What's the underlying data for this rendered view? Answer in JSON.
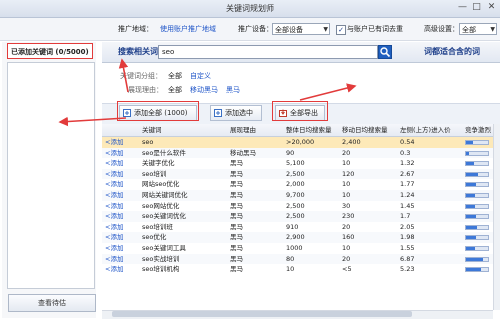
{
  "window": {
    "title": "关键词规划师"
  },
  "settings": {
    "region_label": "推广地域：",
    "region_value": "使用账户推广地域",
    "device_label": "推广设备：",
    "device_value": "全部设备",
    "dedupe_label": "与账户已有词去重",
    "advanced_label": "高级设置：",
    "advanced_value": "全部"
  },
  "left_panel": {
    "added_header": "已添加关键词 (0/5000)",
    "view_button": "查看待估"
  },
  "tabs": {
    "search_related": "搜索相关词",
    "suitable": "词都适合含的词"
  },
  "search": {
    "value": "seo"
  },
  "filters": {
    "group_label": "关键词分组：",
    "group_all": "全部",
    "group_custom": "自定义",
    "reason_label": "展现理由：",
    "reason_all": "全部",
    "reason_mobile": "移动黑马",
    "reason_dark": "黑马"
  },
  "actions": {
    "add_all": "添加全部 (1000)",
    "add_selected": "添加选中",
    "export_all": "全部导出"
  },
  "table": {
    "columns": [
      "关键词",
      "展现理由",
      "整体日均搜索量",
      "移动日均搜索量",
      "左侧(上方)进入价",
      "竞争激烈"
    ],
    "add_label": "<添加",
    "rows": [
      {
        "kw": "seo",
        "reason": "",
        "total": ">20,000",
        "mobile": "2,400",
        "bid": "0.54",
        "comp": 0.3
      },
      {
        "kw": "seo是什么软件",
        "reason": "移动黑马",
        "total": "90",
        "mobile": "20",
        "bid": "0.3",
        "comp": 0.15
      },
      {
        "kw": "关键字优化",
        "reason": "黑马",
        "total": "5,100",
        "mobile": "10",
        "bid": "1.32",
        "comp": 0.35
      },
      {
        "kw": "seo培训",
        "reason": "黑马",
        "total": "2,500",
        "mobile": "120",
        "bid": "2.67",
        "comp": 0.55
      },
      {
        "kw": "网站seo优化",
        "reason": "黑马",
        "total": "2,000",
        "mobile": "10",
        "bid": "1.77",
        "comp": 0.45
      },
      {
        "kw": "网站关键词优化",
        "reason": "黑马",
        "total": "9,700",
        "mobile": "10",
        "bid": "1.24",
        "comp": 0.4
      },
      {
        "kw": "seo网站优化",
        "reason": "黑马",
        "total": "2,500",
        "mobile": "30",
        "bid": "1.45",
        "comp": 0.4
      },
      {
        "kw": "seo关键词优化",
        "reason": "黑马",
        "total": "2,500",
        "mobile": "230",
        "bid": "1.7",
        "comp": 0.45
      },
      {
        "kw": "seo培训班",
        "reason": "黑马",
        "total": "910",
        "mobile": "20",
        "bid": "2.05",
        "comp": 0.5
      },
      {
        "kw": "seo优化",
        "reason": "黑马",
        "total": "2,900",
        "mobile": "160",
        "bid": "1.98",
        "comp": 0.45
      },
      {
        "kw": "seo关键词工具",
        "reason": "黑马",
        "total": "1000",
        "mobile": "10",
        "bid": "1.55",
        "comp": 0.4
      },
      {
        "kw": "seo实战培训",
        "reason": "黑马",
        "total": "80",
        "mobile": "20",
        "bid": "6.87",
        "comp": 0.75
      },
      {
        "kw": "seo培训机构",
        "reason": "黑马",
        "total": "10",
        "mobile": "<5",
        "bid": "5.23",
        "comp": 0.7
      }
    ]
  }
}
